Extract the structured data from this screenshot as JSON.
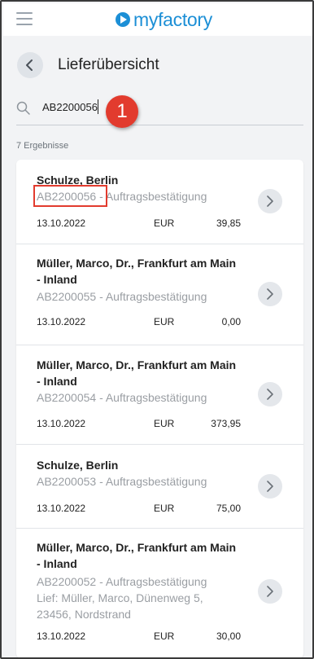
{
  "app": {
    "logo_prefix": "my",
    "logo_suffix": "factory",
    "brand_color": "#1c8fd6"
  },
  "header": {
    "title": "Lieferübersicht"
  },
  "search": {
    "value": "AB2200056",
    "step_badge": "1"
  },
  "results": {
    "count_label": "7 Ergebnisse",
    "items": [
      {
        "name": "Schulze, Berlin",
        "doc": "AB2200056 - Auftragsbestätigung",
        "date": "13.10.2022",
        "currency": "EUR",
        "amount": "39,85"
      },
      {
        "name": "Müller, Marco, Dr., Frankfurt am Main - Inland",
        "doc": "AB2200055 - Auftragsbestätigung",
        "date": "13.10.2022",
        "currency": "EUR",
        "amount": "0,00"
      },
      {
        "name": "Müller, Marco, Dr., Frankfurt am Main - Inland",
        "doc": "AB2200054 - Auftragsbestätigung",
        "date": "13.10.2022",
        "currency": "EUR",
        "amount": "373,95"
      },
      {
        "name": "Schulze, Berlin",
        "doc": "AB2200053 - Auftragsbestätigung",
        "date": "13.10.2022",
        "currency": "EUR",
        "amount": "75,00"
      },
      {
        "name": "Müller, Marco, Dr., Frankfurt am Main - Inland",
        "doc": "AB2200052 - Auftragsbestätigung Lief: Müller, Marco, Dünenweg 5, 23456, Nordstrand",
        "date": "13.10.2022",
        "currency": "EUR",
        "amount": "30,00"
      }
    ]
  },
  "colors": {
    "accent_red": "#e23b2e",
    "muted_text": "#9a9ea3"
  }
}
